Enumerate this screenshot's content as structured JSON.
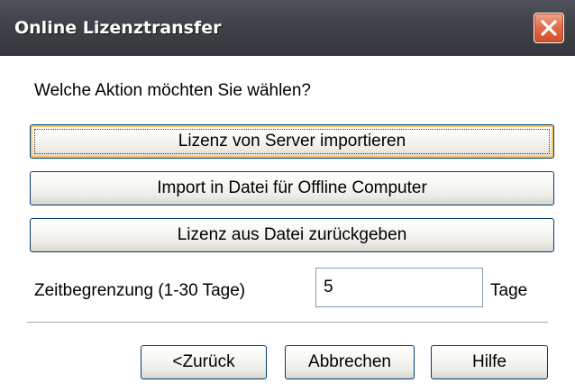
{
  "window": {
    "title": "Online Lizenztransfer",
    "close_icon": "close-icon",
    "colors": {
      "titlebar": "#3f4248",
      "close_button": "#e26f4c",
      "button_border": "#003c74",
      "focus_highlight": "#f5c66e"
    }
  },
  "dialog": {
    "prompt": "Welche Aktion möchten Sie wählen?",
    "actions": {
      "import_server": "Lizenz von Server importieren",
      "import_offline": "Import in Datei für Offline Computer",
      "return_file": "Lizenz aus Datei zurückgeben"
    },
    "time_limit": {
      "label": "Zeitbegrenzung (1-30 Tage)",
      "value": "5",
      "unit": "Tage"
    },
    "footer": {
      "back": "<Zurück",
      "cancel": "Abbrechen",
      "help": "Hilfe"
    }
  }
}
